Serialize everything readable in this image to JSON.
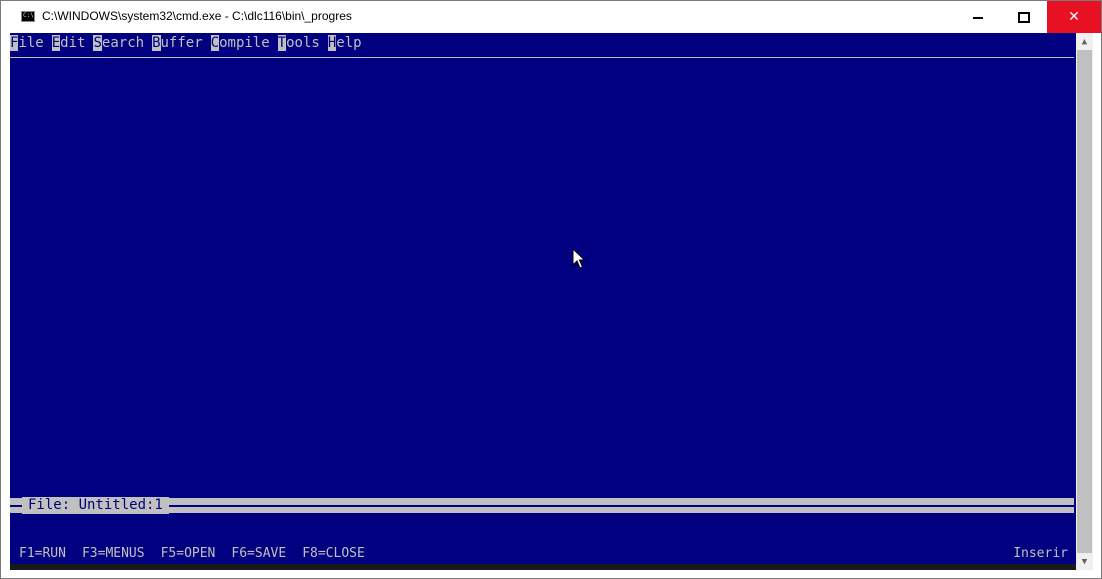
{
  "window": {
    "title": "C:\\WINDOWS\\system32\\cmd.exe - C:\\dlc116\\bin\\_progres",
    "icon_text": "C:\\",
    "close_glyph": "✕"
  },
  "menu": [
    {
      "hot": "F",
      "rest": "ile"
    },
    {
      "hot": "E",
      "rest": "dit"
    },
    {
      "hot": "S",
      "rest": "earch"
    },
    {
      "hot": "B",
      "rest": "uffer"
    },
    {
      "hot": "C",
      "rest": "ompile"
    },
    {
      "hot": "T",
      "rest": "ools"
    },
    {
      "hot": "H",
      "rest": "elp"
    }
  ],
  "status": {
    "label": "File: Untitled:1"
  },
  "function_keys": [
    "F1=RUN",
    "F3=MENUS",
    "F5=OPEN",
    "F6=SAVE",
    "F8=CLOSE"
  ],
  "mode": "Inserir",
  "scroll": {
    "up_glyph": "▲",
    "down_glyph": "▼"
  },
  "colors": {
    "console_bg": "#000080",
    "console_fg": "#c0c0c0",
    "close_button": "#e81123"
  }
}
